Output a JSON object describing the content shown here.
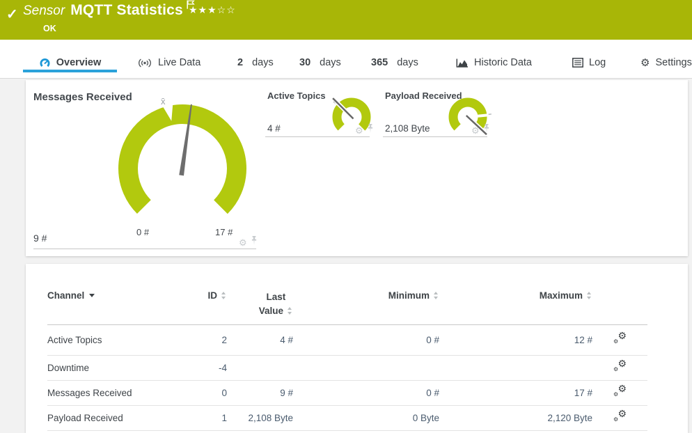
{
  "header": {
    "check": "✓",
    "kind": "Sensor",
    "title": "MQTT Statistics",
    "status": "OK",
    "stars_filled": "★★★",
    "stars_empty": "☆☆",
    "bg_color": "#a8b607"
  },
  "tabs": {
    "overview": {
      "label": "Overview"
    },
    "live_data": {
      "label": "Live Data"
    },
    "days2": {
      "num": "2",
      "unit": "days"
    },
    "days30": {
      "num": "30",
      "unit": "days"
    },
    "days365": {
      "num": "365",
      "unit": "days"
    },
    "historic": {
      "label": "Historic Data"
    },
    "log": {
      "label": "Log"
    },
    "settings": {
      "label": "Settings"
    },
    "accent_color": "#2ba2da"
  },
  "gauges": {
    "lime_color": "#b2c90e",
    "main": {
      "title": "Messages Received",
      "value": "9 #",
      "min_label": "0 #",
      "max_label": "17 #",
      "avg_marker": "x̄"
    },
    "active_topics": {
      "title": "Active Topics",
      "value": "4 #"
    },
    "payload": {
      "title": "Payload Received",
      "value": "2,108 Byte"
    }
  },
  "chart_data": [
    {
      "type": "gauge",
      "title": "Messages Received",
      "value": 9,
      "min": 0,
      "max": 17,
      "unit": "#"
    },
    {
      "type": "gauge",
      "title": "Active Topics",
      "value": 4,
      "min": 0,
      "max": 12,
      "unit": "#"
    },
    {
      "type": "gauge",
      "title": "Payload Received",
      "value": 2108,
      "min": 0,
      "max": 2120,
      "unit": "Byte"
    }
  ],
  "table": {
    "headers": {
      "channel": "Channel",
      "id": "ID",
      "last_line1": "Last",
      "last_line2": "Value",
      "min": "Minimum",
      "max": "Maximum"
    },
    "rows": [
      {
        "channel": "Active Topics",
        "id": "2",
        "last": "4 #",
        "min": "0 #",
        "max": "12 #"
      },
      {
        "channel": "Downtime",
        "id": "-4",
        "last": "",
        "min": "",
        "max": ""
      },
      {
        "channel": "Messages Received",
        "id": "0",
        "last": "9 #",
        "min": "0 #",
        "max": "17 #"
      },
      {
        "channel": "Payload Received",
        "id": "1",
        "last": "2,108 Byte",
        "min": "0 Byte",
        "max": "2,120 Byte"
      }
    ]
  },
  "icons": {
    "gear": "⚙"
  }
}
